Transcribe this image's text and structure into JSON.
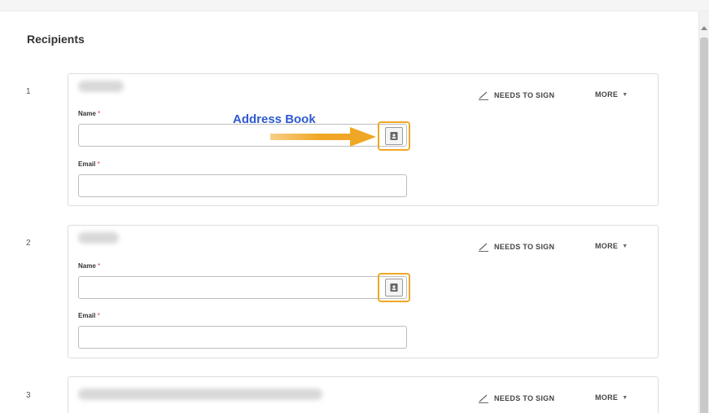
{
  "section": {
    "title": "Recipients"
  },
  "annotation": {
    "text": "Address Book",
    "color": "#2f5bd0",
    "arrow_color": "#f0a725"
  },
  "recipients": [
    {
      "number": "1",
      "role_label": "NEEDS TO SIGN",
      "more_label": "MORE",
      "name_label": "Name",
      "email_label": "Email",
      "required_mark": "*",
      "name_value": "",
      "email_value": ""
    },
    {
      "number": "2",
      "role_label": "NEEDS TO SIGN",
      "more_label": "MORE",
      "name_label": "Name",
      "email_label": "Email",
      "required_mark": "*",
      "name_value": "",
      "email_value": ""
    },
    {
      "number": "3",
      "role_label": "NEEDS TO SIGN",
      "more_label": "MORE"
    }
  ],
  "icons": {
    "pen": "pen-icon",
    "address_book": "address-book-icon",
    "caret": "chevron-down-icon"
  }
}
